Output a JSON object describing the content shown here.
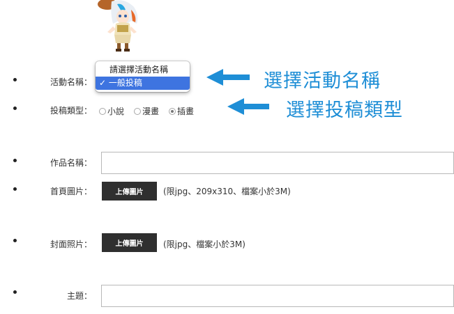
{
  "form": {
    "activity_label": "活動名稱：",
    "activity_dropdown": {
      "options": [
        "請選擇活動名稱",
        "一般投稿"
      ],
      "selected": "✓ 一般投稿"
    },
    "type_label": "投稿類型：",
    "type_options": [
      "小說",
      "漫畫",
      "插畫"
    ],
    "type_selected": "插畫",
    "title_label": "作品名稱：",
    "title_value": "",
    "homepage_label": "首頁圖片：",
    "homepage_button": "上傳圖片",
    "homepage_hint": "(限jpg、209x310、檔案小於3M)",
    "cover_label": "封面照片：",
    "cover_button": "上傳圖片",
    "cover_hint": "(限jpg、檔案小於3M)",
    "theme_label": "主題：",
    "theme_value": ""
  },
  "annotations": {
    "select_activity": "選擇活動名稱",
    "select_type": "選擇投稿類型"
  },
  "colors": {
    "annotation": "#1e8ed6",
    "selected_option": "#3e74e0",
    "button": "#2f2f2f"
  }
}
